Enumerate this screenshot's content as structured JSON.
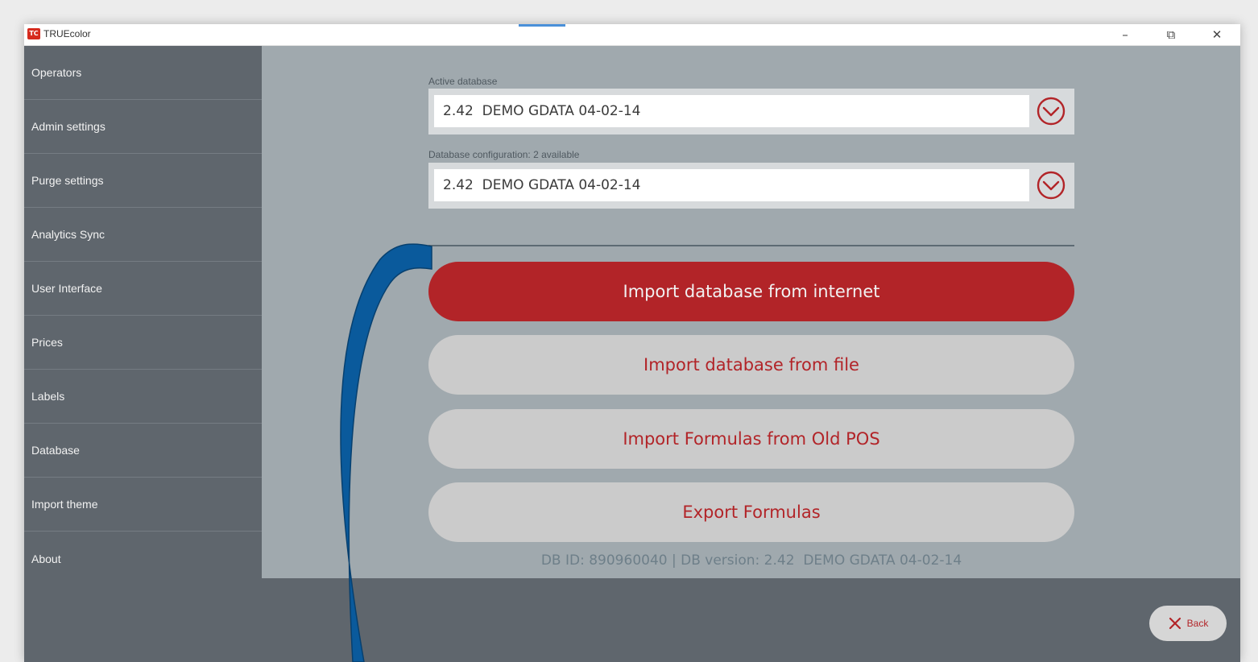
{
  "app": {
    "title": "TRUEcolor",
    "logo_text": "TC"
  },
  "window_controls": {
    "minimize": "–",
    "restore": "⧉",
    "close": "✕"
  },
  "sidebar": {
    "items": [
      {
        "label": "Operators"
      },
      {
        "label": "Admin settings"
      },
      {
        "label": "Purge settings"
      },
      {
        "label": "Analytics Sync"
      },
      {
        "label": "User Interface"
      },
      {
        "label": "Prices"
      },
      {
        "label": "Labels"
      },
      {
        "label": "Database"
      },
      {
        "label": "Import theme"
      },
      {
        "label": "About"
      }
    ]
  },
  "main": {
    "active_database": {
      "label": "Active database",
      "value": "2.42  DEMO GDATA 04-02-14"
    },
    "database_configuration": {
      "label": "Database configuration: 2 available",
      "value": "2.42  DEMO GDATA 04-02-14"
    },
    "buttons": {
      "import_internet": "Import database from internet",
      "import_file": "Import database from file",
      "import_formulas": "Import Formulas from Old POS",
      "export_formulas": "Export Formulas"
    },
    "db_info": "DB ID: 890960040 | DB version: 2.42  DEMO GDATA 04-02-14"
  },
  "footer": {
    "back_label": "Back"
  },
  "colors": {
    "accent": "#b22428",
    "sidebar_bg": "#5f666d",
    "content_bg": "#a0a9ae",
    "annotation_arrow": "#0a5a9c"
  },
  "icons": {
    "dropdown": "chevron-down-circle-icon",
    "back": "close-x-icon",
    "annotation": "curved-arrow-annotation"
  }
}
